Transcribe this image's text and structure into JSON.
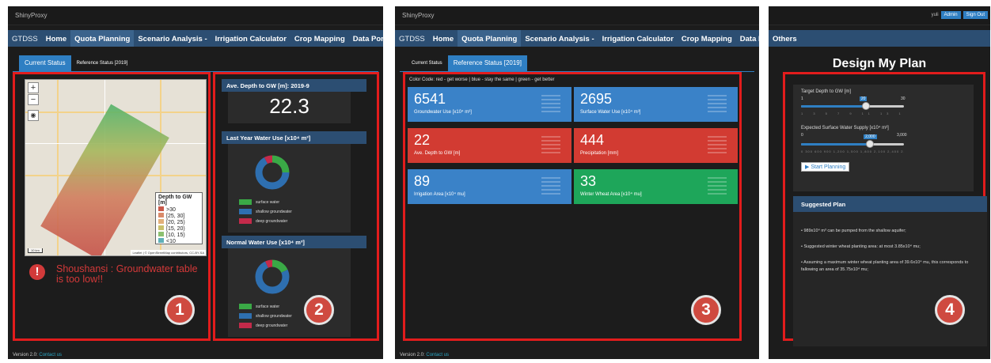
{
  "topbar": {
    "brand": "ShinyProxy"
  },
  "nav": {
    "brand": "GTDSS",
    "items": [
      "Home",
      "Quota Planning",
      "Scenario Analysis -",
      "Irrigation Calculator",
      "Crop Mapping",
      "Data Portal",
      "Ot"
    ],
    "items2": [
      "Home",
      "Quota Planning",
      "Scenario Analysis -",
      "Irrigation Calculator",
      "Crop Mapping",
      "Data Portal"
    ],
    "others": "Others"
  },
  "tabs": {
    "current": "Current Status",
    "reference": "Reference Status [2019]"
  },
  "map": {
    "zoom_in": "+",
    "zoom_out": "−",
    "locate": "◉",
    "scale": "10 km",
    "attribution": "Leaflet | © OpenStreetMap contributors, CC-BY-SA",
    "legend": {
      "title": "Depth to GW [m]",
      "items": [
        {
          "label": ">30",
          "color": "#c9594a"
        },
        {
          "label": "[25, 30]",
          "color": "#d98a6a"
        },
        {
          "label": "[20, 25)",
          "color": "#e2b07a"
        },
        {
          "label": "[15, 20)",
          "color": "#c9c06b"
        },
        {
          "label": "[10, 15)",
          "color": "#8cc070"
        },
        {
          "label": "<10",
          "color": "#5fb0b8"
        }
      ]
    }
  },
  "alert": {
    "icon": "!",
    "text": "Shoushansi : Groundwater table is too low!!"
  },
  "panels": {
    "depth_title": "Ave. Depth to GW [m]: 2019-9",
    "depth_value": "22.3",
    "last_title": "Last Year Water Use [x10⁴ m³]",
    "normal_title": "Normal Water Use [x10⁴ m³]",
    "legend": [
      {
        "label": "surface water",
        "color": "#3aa946"
      },
      {
        "label": "shallow groundwater",
        "color": "#2e6fb0"
      },
      {
        "label": "deep groundwater",
        "color": "#c42a4a"
      }
    ]
  },
  "chart_data": [
    {
      "type": "pie",
      "title": "Last Year Water Use [x10⁴ m³]",
      "labels": [
        "surface water",
        "shallow groundwater",
        "deep groundwater"
      ],
      "values": [
        25,
        67,
        8
      ],
      "colors": [
        "#3aa946",
        "#2e6fb0",
        "#c42a4a"
      ]
    },
    {
      "type": "pie",
      "title": "Normal Water Use [x10⁴ m³]",
      "labels": [
        "surface water",
        "shallow groundwater",
        "deep groundwater"
      ],
      "values": [
        18,
        75,
        7
      ],
      "colors": [
        "#3aa946",
        "#2e6fb0",
        "#c42a4a"
      ]
    }
  ],
  "color_code": "Color Code: red - get worse | blue - stay the same | green - get better",
  "kpis": [
    {
      "value": "6541",
      "label": "Groundwater Use [x10⁴ m³]",
      "color": "blue"
    },
    {
      "value": "2695",
      "label": "Surface Water Use [x10⁴ m³]",
      "color": "blue"
    },
    {
      "value": "22",
      "label": "Ave. Depth to GW [m]",
      "color": "red"
    },
    {
      "value": "444",
      "label": "Precipitation [mm]",
      "color": "red"
    },
    {
      "value": "89",
      "label": "Irrigation Area [x10⁴ mu]",
      "color": "blue"
    },
    {
      "value": "33",
      "label": "Winter Wheat Area [x10⁴ mu]",
      "color": "green"
    }
  ],
  "user": {
    "name": "yuli",
    "admin": "Admin",
    "signout": "Sign Out"
  },
  "plan": {
    "title": "Design My Plan",
    "target_label": "Target Depth to GW [m]",
    "target_min": "1",
    "target_max": "30",
    "target_value": "20",
    "target_fraction": 0.63,
    "target_ticks": "1 3 5 7 9 11 13 15 17 20 22 25 27 30",
    "surface_label": "Expected Surface Water Supply [x10⁴ m³]",
    "surface_min": "0",
    "surface_max": "3,000",
    "surface_value": "2,000",
    "surface_fraction": 0.67,
    "surface_ticks": "0 300 600 900 1,200 1,500 1,800 2,100 2,400 2,700 3,000",
    "start": "Start Planning",
    "suggested": "Suggested Plan",
    "lines": [
      "• 989x10⁴ m³ can be pumped from the shallow aquifer;",
      "• Suggested winter wheat planting area: at most 3.85x10⁴ mu;",
      "• Assuming a maximum winter wheat planting area of 39.6x10⁴ mu, this corresponds to fallowing an area of 35.75x10⁴ mu;"
    ]
  },
  "badges": [
    "1",
    "2",
    "3",
    "4"
  ],
  "footer": {
    "version": "Version 2.0:",
    "contact": "Contact us"
  }
}
